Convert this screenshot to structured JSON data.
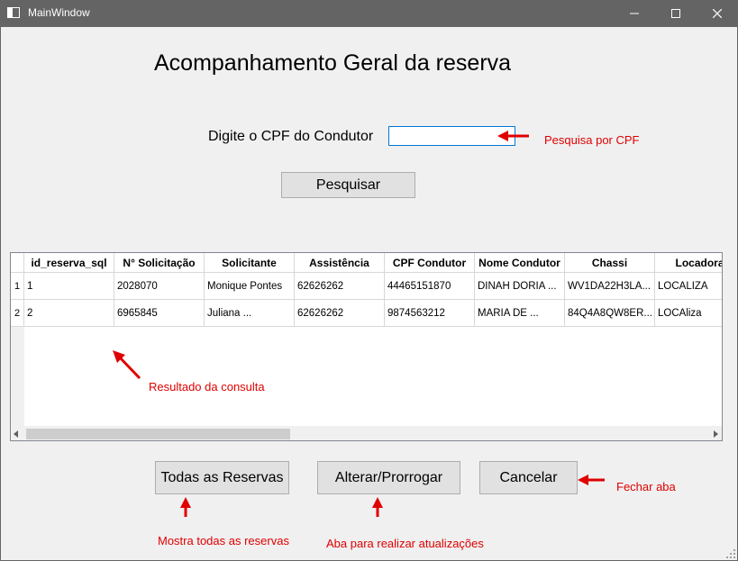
{
  "window": {
    "title": "MainWindow"
  },
  "page": {
    "heading": "Acompanhamento Geral da reserva",
    "cpf_label": "Digite o CPF do Condutor",
    "cpf_value": "",
    "search_button": "Pesquisar"
  },
  "table": {
    "columns": [
      "id_reserva_sql",
      "N° Solicitação",
      "Solicitante",
      "Assistência",
      "CPF Condutor",
      "Nome Condutor",
      "Chassi",
      "Locadora"
    ],
    "rows": [
      {
        "num": "1",
        "cells": [
          "1",
          "2028070",
          "Monique Pontes",
          "62626262",
          "44465151870",
          "DINAH DORIA ...",
          "WV1DA22H3LA...",
          "LOCALIZA"
        ]
      },
      {
        "num": "2",
        "cells": [
          "2",
          "6965845",
          "Juliana ...",
          "62626262",
          "9874563212",
          "MARIA DE ...",
          "84Q4A8QW8ER...",
          "LOCAliza"
        ]
      }
    ]
  },
  "buttons": {
    "all": "Todas as Reservas",
    "edit": "Alterar/Prorrogar",
    "cancel": "Cancelar"
  },
  "annotations": {
    "search_cpf": "Pesquisa por CPF",
    "result": "Resultado da consulta",
    "close_tab": "Fechar aba",
    "all_reservations": "Mostra todas as reservas",
    "update_tab": "Aba para realizar atualizações"
  },
  "colors": {
    "annotation": "#e00000",
    "titlebar": "#646464",
    "focus": "#0078d7"
  }
}
